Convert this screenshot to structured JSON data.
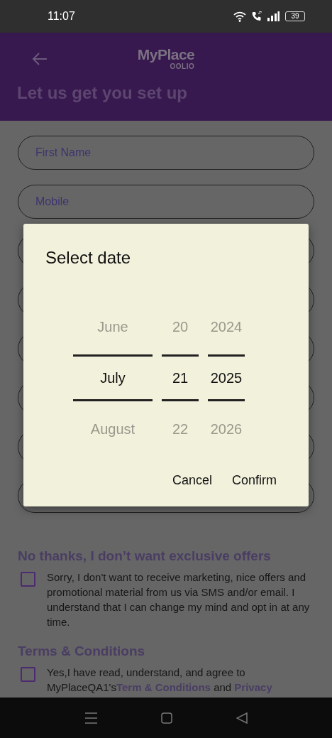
{
  "status_bar": {
    "time": "11:07",
    "battery": "39"
  },
  "header": {
    "logo": "MyPlace",
    "logo_sub": "OOLIO",
    "heading": "Let us get you set up"
  },
  "fields": [
    {
      "placeholder": "First Name"
    },
    {
      "placeholder": "Mobile"
    },
    {
      "kind": "covered"
    },
    {
      "kind": "covered"
    },
    {
      "kind": "covered"
    },
    {
      "kind": "covered"
    },
    {
      "kind": "covered"
    },
    {
      "kind": "covered"
    }
  ],
  "sections": [
    {
      "heading": "No thanks, I don’t want exclusive offers",
      "checked": false,
      "segments": [
        {
          "kind": "text",
          "text": "Sorry, I don't want to receive marketing, nice offers and promotional material from us via SMS and/or email. I understand that I can change my mind and opt in at any time."
        }
      ]
    },
    {
      "heading": "Terms & Conditions",
      "checked": false,
      "segments": [
        {
          "kind": "text",
          "text": "Yes,I have read, understand, and agree to MyPlaceQA1's"
        },
        {
          "kind": "link",
          "text": "Term & Conditions"
        },
        {
          "kind": "text",
          "text": " and "
        },
        {
          "kind": "link",
          "text": "Privacy"
        }
      ]
    }
  ],
  "dialog": {
    "title": "Select date",
    "columns": [
      {
        "items": [
          {
            "label": "June",
            "selected": false
          },
          {
            "label": "July",
            "selected": true
          },
          {
            "label": "August",
            "selected": false
          }
        ]
      },
      {
        "items": [
          {
            "label": "20",
            "selected": false
          },
          {
            "label": "21",
            "selected": true
          },
          {
            "label": "22",
            "selected": false
          }
        ]
      },
      {
        "items": [
          {
            "label": "2024",
            "selected": false
          },
          {
            "label": "2025",
            "selected": true
          },
          {
            "label": "2026",
            "selected": false
          }
        ]
      }
    ],
    "buttons": [
      "Cancel",
      "Confirm"
    ]
  }
}
